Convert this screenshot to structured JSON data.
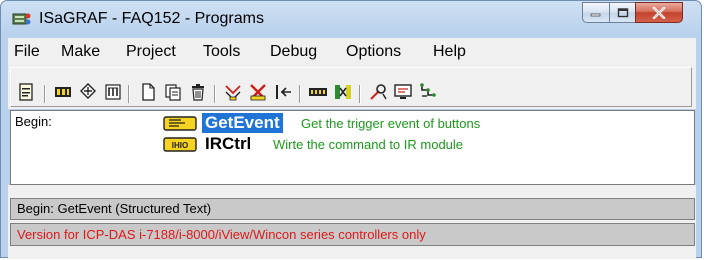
{
  "window": {
    "title": "ISaGRAF - FAQ152 - Programs",
    "icon": "isagraf-app-icon",
    "controls": {
      "minimize": "minimize-icon",
      "maximize": "maximize-icon",
      "close": "close-icon"
    }
  },
  "menubar": {
    "items": [
      {
        "label": "File"
      },
      {
        "label": "Make"
      },
      {
        "label": "Project"
      },
      {
        "label": "Tools"
      },
      {
        "label": "Debug"
      },
      {
        "label": "Options"
      },
      {
        "label": "Help"
      }
    ]
  },
  "toolbar": {
    "buttons": [
      "properties-icon",
      "dictionary-icon",
      "io-connection-icon",
      "library-icon",
      "new-program-icon",
      "copy-icon",
      "delete-icon",
      "compile-icon",
      "verify-icon",
      "simulate-icon",
      "download-icon",
      "link-icon",
      "debug-icon",
      "monitor-icon",
      "cross-reference-icon"
    ]
  },
  "programs": {
    "section_label": "Begin:",
    "items": [
      {
        "name": "GetEvent",
        "description": "Get the trigger event of buttons",
        "language": "ST",
        "selected": true
      },
      {
        "name": "IRCtrl",
        "description": "Wirte the command to IR module",
        "language": "IHIO",
        "selected": false
      }
    ]
  },
  "status": {
    "text": "Begin:  GetEvent   (Structured Text)",
    "warning": "Version for ICP-DAS i-7188/i-8000/iView/Wincon series controllers only"
  },
  "colors": {
    "selection": "#1f74d6",
    "description": "#1d9a1d",
    "warning": "#e01818",
    "program_icon": "#f6d320"
  }
}
